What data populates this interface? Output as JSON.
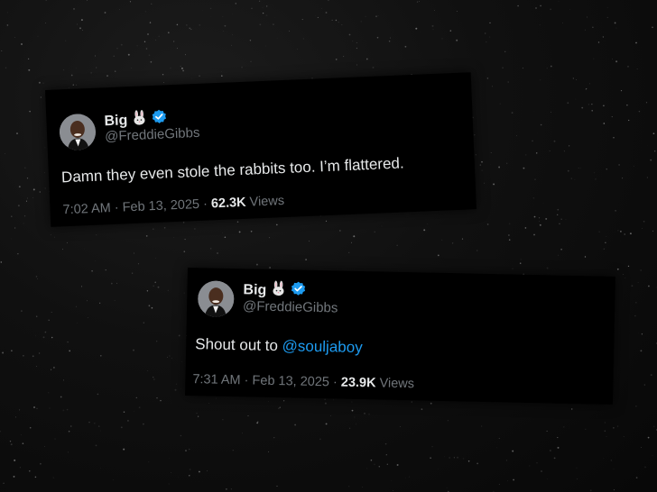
{
  "background_color": "#0d0d0d",
  "accent": "#1d9bf0",
  "tweets": [
    {
      "display_name": "Big",
      "name_emoji_icon": "rabbit-icon",
      "verified_icon": "verified-badge-icon",
      "handle": "@FreddieGibbs",
      "text_before": "Damn they even stole the rabbits too.  I’m flattered.",
      "mention": "",
      "time": "7:02 AM",
      "separator": "·",
      "date": "Feb 13, 2025",
      "views_count": "62.3K",
      "views_label": "Views"
    },
    {
      "display_name": "Big",
      "name_emoji_icon": "rabbit-icon",
      "verified_icon": "verified-badge-icon",
      "handle": "@FreddieGibbs",
      "text_before": "Shout out to ",
      "mention": "@souljaboy",
      "time": "7:31 AM",
      "separator": "·",
      "date": "Feb 13, 2025",
      "views_count": "23.9K",
      "views_label": "Views"
    }
  ]
}
